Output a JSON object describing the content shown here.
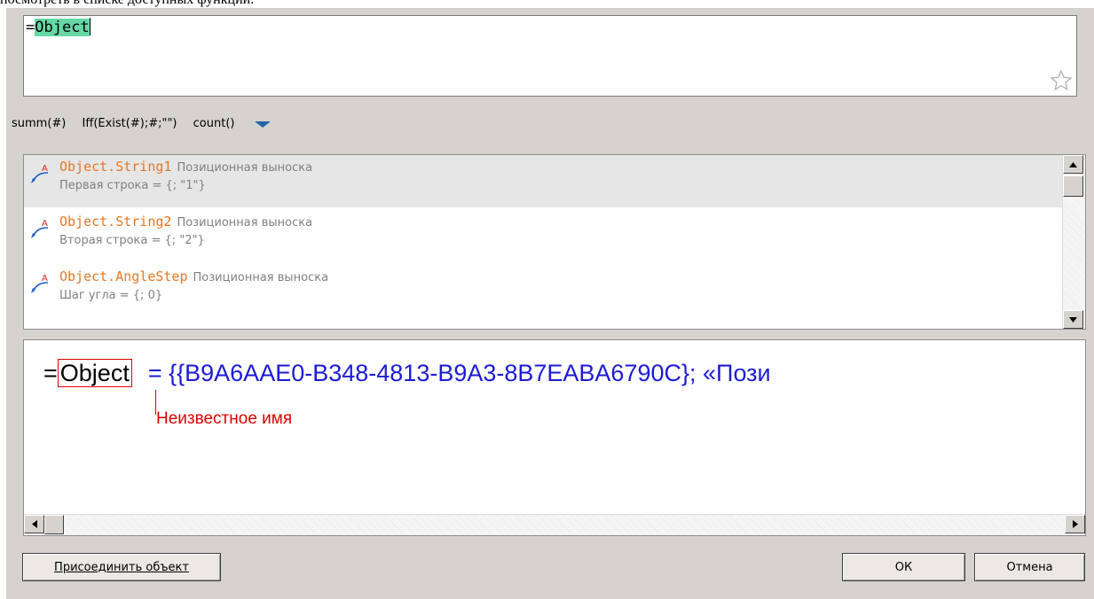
{
  "page": {
    "top_text": "посмотреть в списке доступных функций."
  },
  "formula": {
    "prefix": "=",
    "highlighted": "Object"
  },
  "quick_functions": [
    "summ(#)",
    "Iff(Exist(#);#;\"\")",
    "count()"
  ],
  "suggestions": [
    {
      "name": "Object.String1",
      "type": "Позиционная выноска",
      "desc": "Первая строка = {; \"1\"}"
    },
    {
      "name": "Object.String2",
      "type": "Позиционная выноска",
      "desc": "Вторая строка = {; \"2\"}"
    },
    {
      "name": "Object.AngleStep",
      "type": "Позиционная выноска",
      "desc": "Шаг угла = {; 0}"
    }
  ],
  "result": {
    "eq": "=",
    "token": "Object",
    "value": "= {{B9A6AAE0-B348-4813-B9A3-8B7EABA6790C}; «Пози",
    "error": "Неизвестное имя"
  },
  "buttons": {
    "attach": "Присоединить объект",
    "ok": "ОК",
    "cancel": "Отмена"
  },
  "colors": {
    "highlight": "#67d8a5",
    "suggest_name": "#e87722",
    "result_value": "#1b1bd6",
    "error": "#e00000"
  }
}
